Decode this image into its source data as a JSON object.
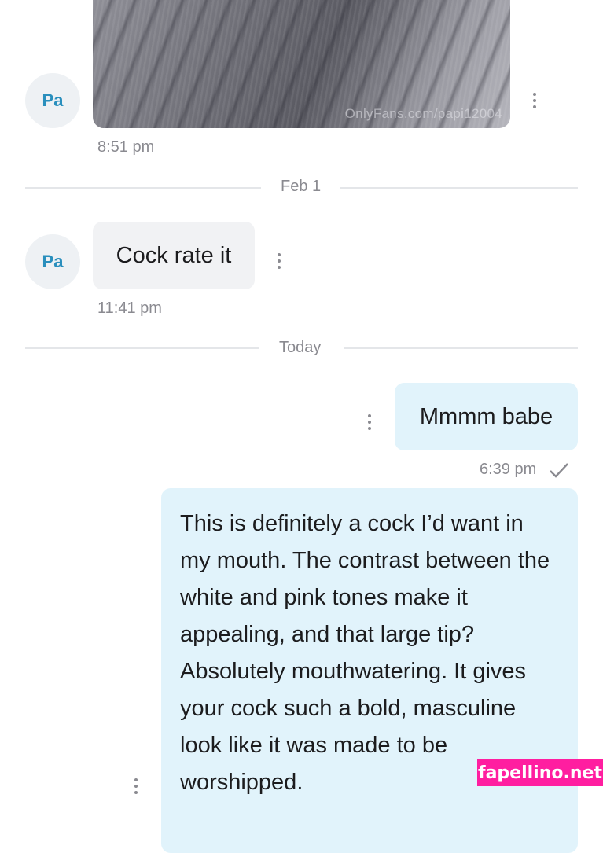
{
  "messages": {
    "photo": {
      "watermark": "OnlyFans.com/papi12004",
      "avatar_initials": "Pa",
      "time": "8:51 pm"
    },
    "divider_1": "Feb 1",
    "incoming": {
      "avatar_initials": "Pa",
      "text": "Cock rate it",
      "time": "11:41 pm"
    },
    "divider_2": "Today",
    "outgoing_1": {
      "text": "Mmmm babe",
      "time": "6:39 pm"
    },
    "outgoing_2": {
      "text": "This is definitely a cock I’d want in my mouth. The contrast between the white and pink tones make it appealing, and that large tip? Absolutely mouthwatering. It gives your cock such a bold, masculine look like it was made to be worshipped."
    }
  },
  "site_badge": "fapellino.net",
  "colors": {
    "accent": "#2a8fbd",
    "outgoing_bubble": "#e1f3fb",
    "incoming_bubble": "#f1f2f4",
    "badge": "#ff1ea0"
  },
  "icons": [
    "more-vertical-icon",
    "checkmark-icon"
  ]
}
